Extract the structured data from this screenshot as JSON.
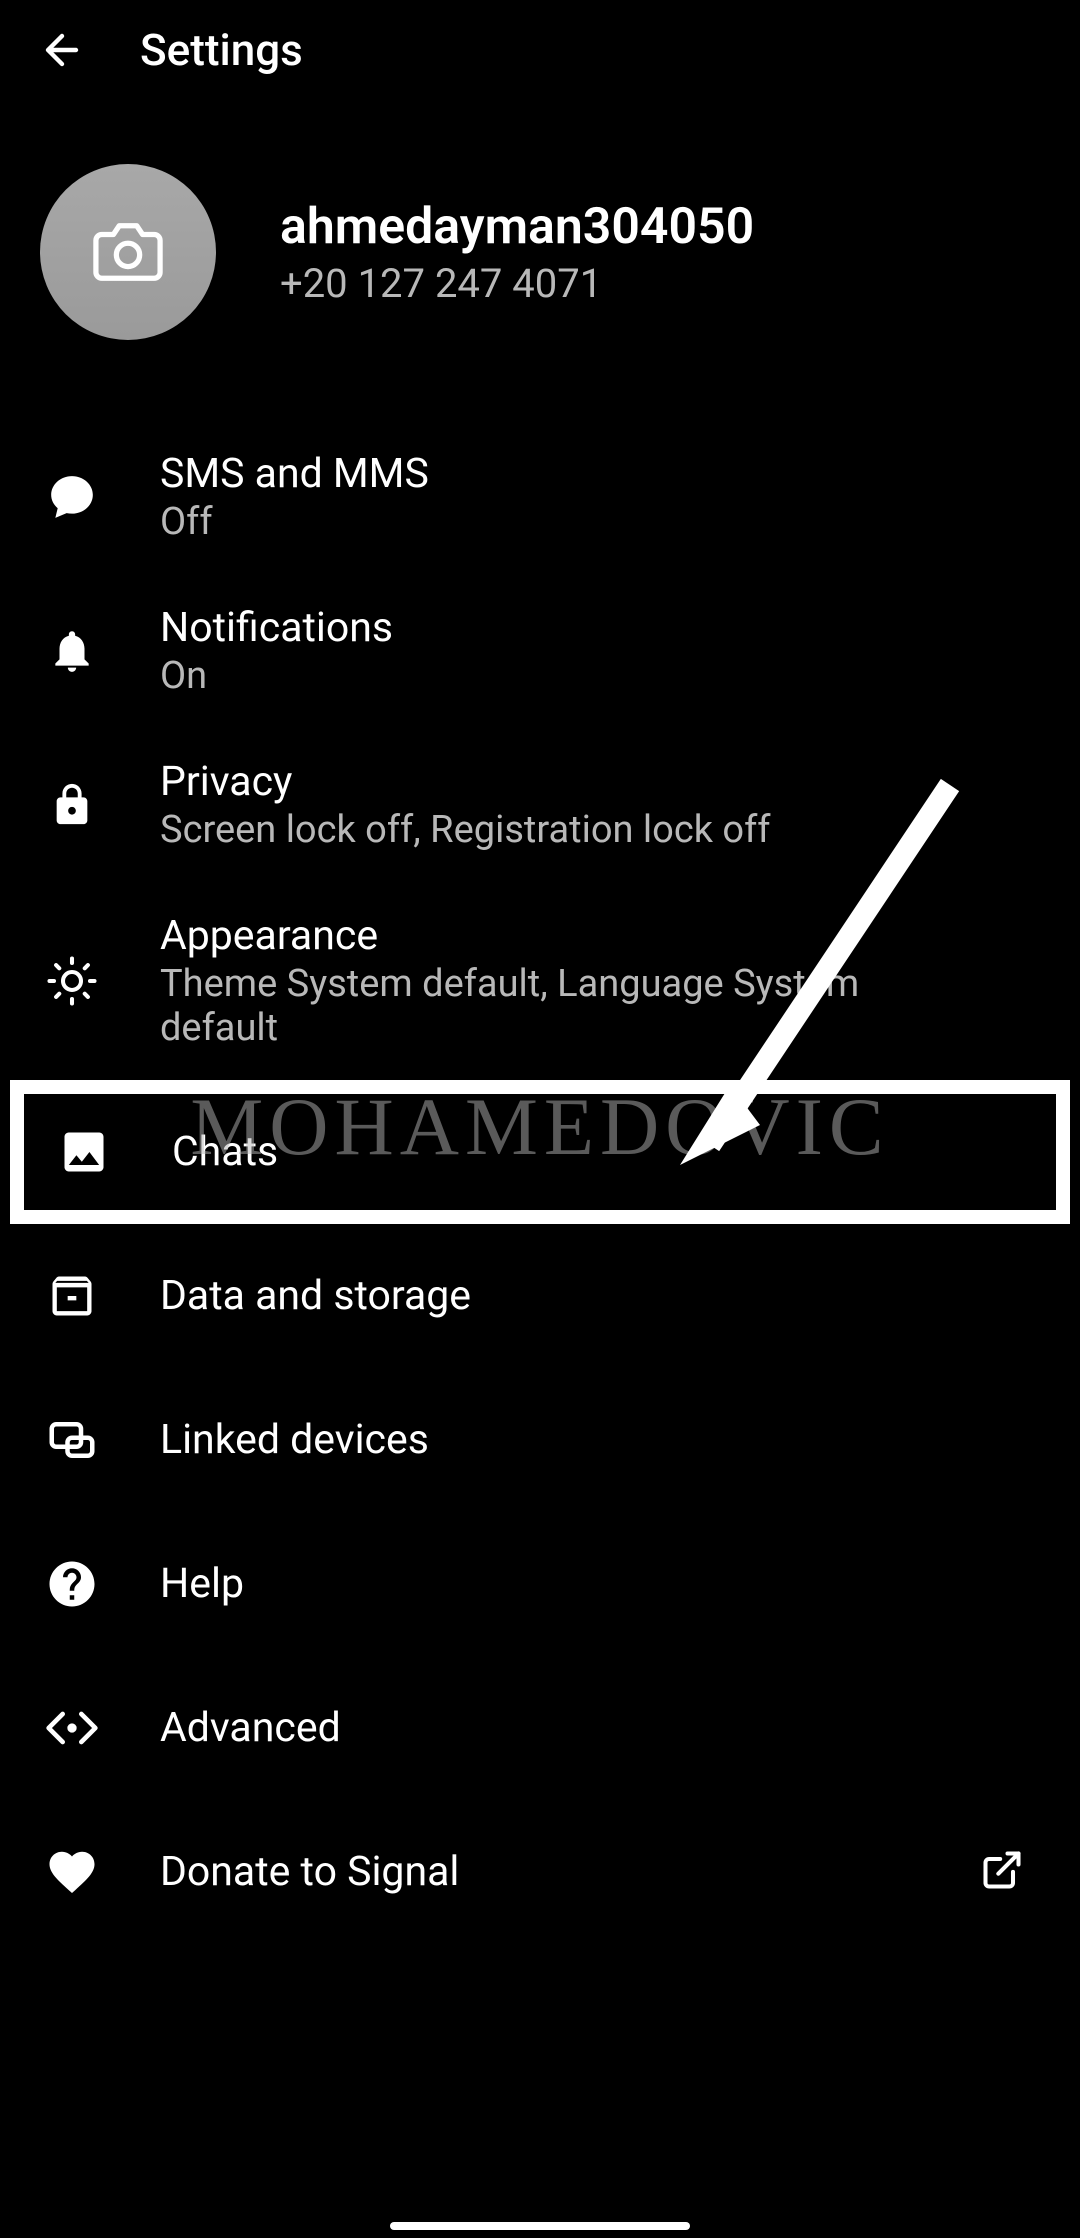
{
  "header": {
    "title": "Settings"
  },
  "profile": {
    "name": "ahmedayman304050",
    "phone": "+20 127 247 4071"
  },
  "items": [
    {
      "title": "SMS and MMS",
      "subtitle": "Off",
      "icon": "chat-bubble"
    },
    {
      "title": "Notifications",
      "subtitle": "On",
      "icon": "bell"
    },
    {
      "title": "Privacy",
      "subtitle": "Screen lock off, Registration lock off",
      "icon": "lock"
    },
    {
      "title": "Appearance",
      "subtitle": "Theme System default, Language System default",
      "icon": "brightness"
    },
    {
      "title": "Chats",
      "subtitle": "",
      "icon": "image"
    },
    {
      "title": "Data and storage",
      "subtitle": "",
      "icon": "archive"
    },
    {
      "title": "Linked devices",
      "subtitle": "",
      "icon": "devices"
    },
    {
      "title": "Help",
      "subtitle": "",
      "icon": "help"
    },
    {
      "title": "Advanced",
      "subtitle": "",
      "icon": "code"
    },
    {
      "title": "Donate to Signal",
      "subtitle": "",
      "icon": "heart"
    }
  ],
  "watermark": "MOHAMEDOVIC"
}
